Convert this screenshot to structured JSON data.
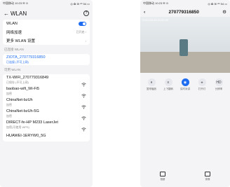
{
  "left": {
    "status_time": "中国移动 10:23 ✉ ⊙",
    "status_right": "◎ ✿ ⊞ ⁴ᴳ 54 ▭",
    "title": "WLAN",
    "settings": [
      {
        "label": "WLAN",
        "right": ""
      },
      {
        "label": "网络加速",
        "right": "已开启 ›"
      },
      {
        "label": "更多 WLAN 设置",
        "right": "›"
      }
    ],
    "connected_label": "已连接 WLAN",
    "connected": {
      "name": "ZIOTA_270779316850",
      "sub": "已连接 (不可上网)"
    },
    "available_label": "可用 WLAN",
    "networks": [
      {
        "name": "TX-WIFI_270779316849",
        "sub": "已保存 (不可上网)"
      },
      {
        "name": "baobao-wifi_Wi-Fi5",
        "sub": "加密"
      },
      {
        "name": "ChinaNet-bzUh",
        "sub": "加密"
      },
      {
        "name": "ChinaNet-bzUh-5G",
        "sub": "加密"
      },
      {
        "name": "DIRECT-fe-HP M233 LaserJet",
        "sub": "加密(可使用 WPS)"
      },
      {
        "name": "HUAWEI-1ERYW0_5G",
        "sub": ""
      }
    ]
  },
  "right": {
    "status_time": "中国移动 10:23 ✉ ⊙",
    "status_right": "◎ ✿ ⊞ ⁴ᴳ 54 ▭",
    "title": "270779316850",
    "timestamp": "2024-09-23 10:25:09",
    "controls": [
      {
        "icon": "⏸",
        "label": "暂停播放"
      },
      {
        "icon": "≡",
        "label": "上下翻转"
      },
      {
        "icon": "◉",
        "label": "实时对讲"
      },
      {
        "icon": "⚹",
        "label": "打开灯"
      },
      {
        "icon": "HD",
        "label": "分辨率"
      }
    ],
    "bottom": [
      {
        "label": "相册"
      },
      {
        "label": "录像"
      }
    ]
  },
  "colors": {
    "accent": "#1e6cf0"
  }
}
